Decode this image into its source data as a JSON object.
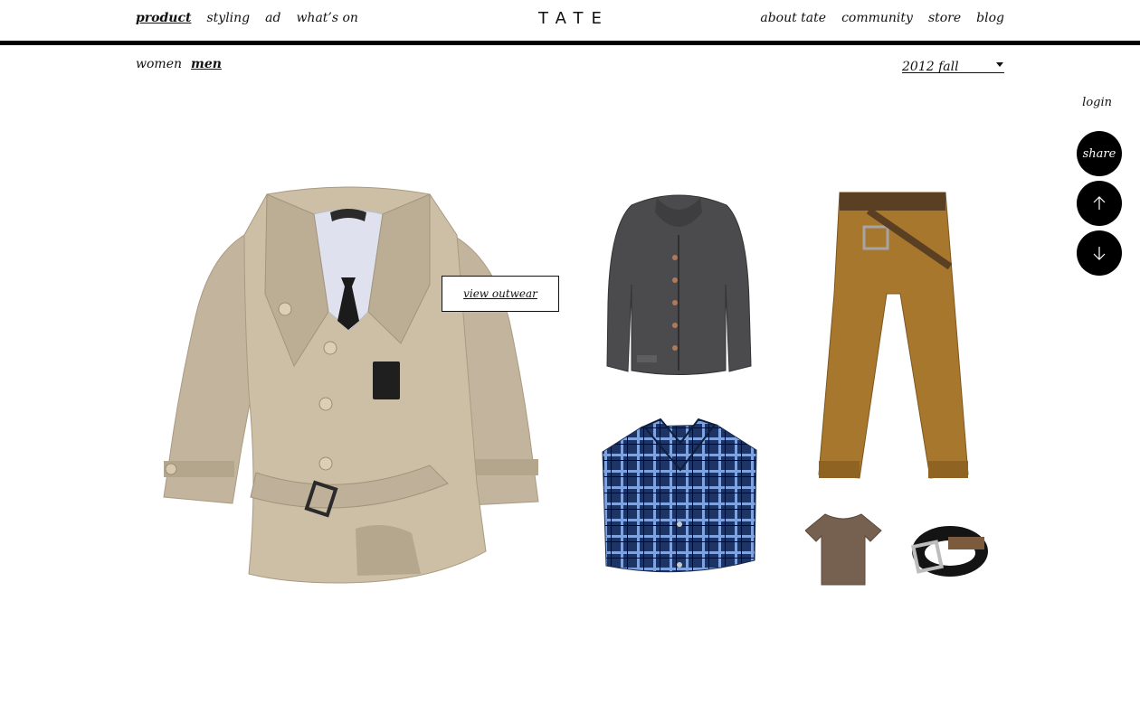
{
  "brand": {
    "logo": "TATE"
  },
  "nav": {
    "left": [
      {
        "label": "product",
        "active": true
      },
      {
        "label": "styling",
        "active": false
      },
      {
        "label": "ad",
        "active": false
      },
      {
        "label": "what’s on",
        "active": false
      }
    ],
    "right": [
      {
        "label": "about tate"
      },
      {
        "label": "community"
      },
      {
        "label": "store"
      },
      {
        "label": "blog"
      }
    ]
  },
  "subnav": {
    "genders": [
      {
        "label": "women",
        "active": false
      },
      {
        "label": "men",
        "active": true
      }
    ],
    "season": {
      "selected": "2012 fall"
    }
  },
  "side": {
    "login": "login",
    "share": "share",
    "up_icon": "arrow-up-icon",
    "down_icon": "arrow-down-icon"
  },
  "main": {
    "view_button": "view outwear",
    "products": [
      {
        "name": "trench-coat",
        "color": "#c9bca6"
      },
      {
        "name": "shawl-cardigan",
        "color": "#4b4a4c"
      },
      {
        "name": "chino-pants",
        "color": "#a8772e"
      },
      {
        "name": "plaid-shirt",
        "color": "#2f4e86"
      },
      {
        "name": "tshirt",
        "color": "#76604f"
      },
      {
        "name": "belt",
        "color": "#141414"
      }
    ]
  }
}
